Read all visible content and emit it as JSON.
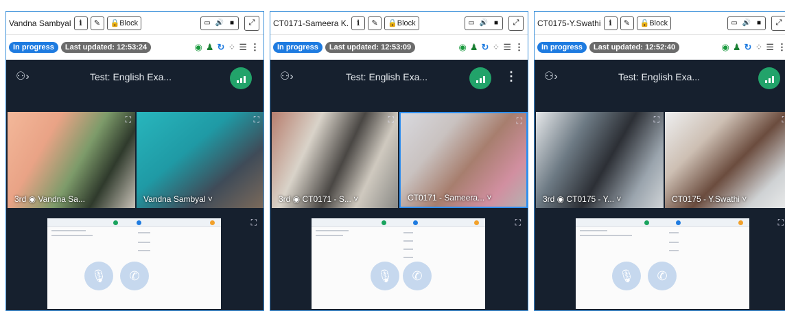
{
  "panels": [
    {
      "name": "Vandna Sambyal",
      "info_label": "i",
      "edit_icon": "edit-icon",
      "block_label": "Block",
      "status_badge": "In progress",
      "last_updated": "Last updated: 12:53:24",
      "test_name": "Test: English Exa...",
      "tile_left_label": "3rd ◉ Vandna Sa...",
      "tile_right_label": "Vandna Sambyal ˅"
    },
    {
      "name": "CT0171-Sameera K.",
      "info_label": "i",
      "edit_icon": "edit-icon",
      "block_label": "Block",
      "status_badge": "In progress",
      "last_updated": "Last updated: 12:53:09",
      "test_name": "Test: English Exa...",
      "tile_left_label": "3rd ◉ CT0171 - S... ˅",
      "tile_right_label": "CT0171 - Sameera... ˅"
    },
    {
      "name": "CT0175-Y.Swathi",
      "info_label": "i",
      "edit_icon": "edit-icon",
      "block_label": "Block",
      "status_badge": "In progress",
      "last_updated": "Last updated: 12:52:40",
      "test_name": "Test: English Exa...",
      "tile_left_label": "3rd ◉ CT0175 - Y... ˅",
      "tile_right_label": "CT0175 - Y.Swathi ˅"
    }
  ],
  "icons": {
    "lock": "lock-icon",
    "screen": "monitor-icon",
    "audio": "speaker-icon",
    "video": "camera-icon",
    "expand": "expand-icon",
    "eye": "eye-icon",
    "user": "user-icon",
    "sync": "sync-icon",
    "loading": "loading-icon",
    "list": "list-icon",
    "more": "more-vertical-icon",
    "mic": "mic-icon",
    "call": "phone-icon"
  },
  "colors": {
    "accent": "#1e7be0",
    "panel_border": "#3a8fd9",
    "dark_bg": "#16202e",
    "signal_green": "#22a36a",
    "updated_badge": "#6b6b6b"
  }
}
